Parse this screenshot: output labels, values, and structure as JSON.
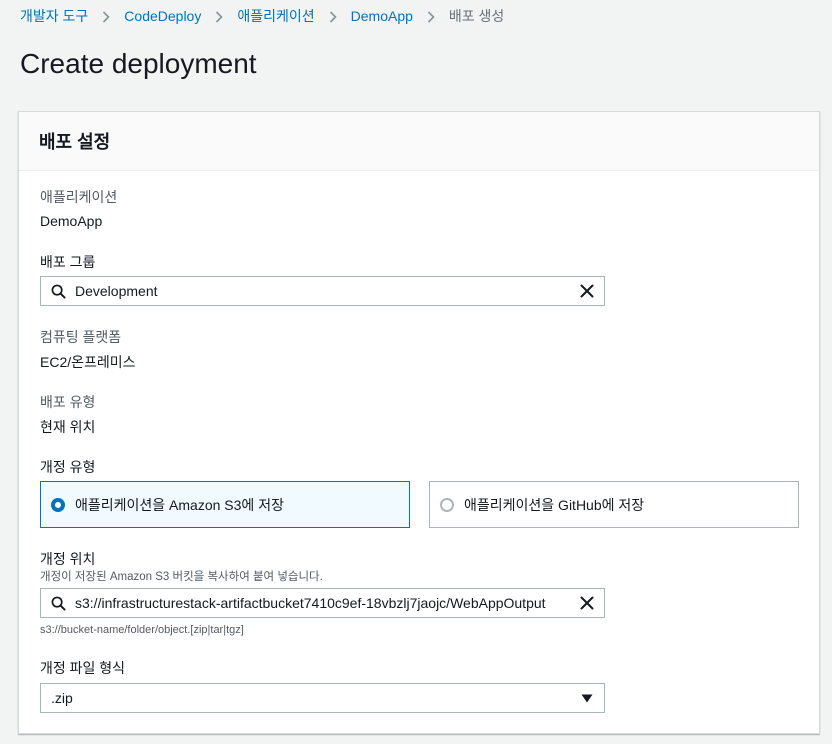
{
  "breadcrumb": [
    {
      "label": "개발자 도구",
      "link": true
    },
    {
      "label": "CodeDeploy",
      "link": true
    },
    {
      "label": "애플리케이션",
      "link": true
    },
    {
      "label": "DemoApp",
      "link": true
    },
    {
      "label": "배포 생성",
      "link": false
    }
  ],
  "page_title": "Create deployment",
  "panel": {
    "title": "배포 설정",
    "application": {
      "label": "애플리케이션",
      "value": "DemoApp"
    },
    "deployment_group": {
      "label": "배포 그룹",
      "value": "Development"
    },
    "compute_platform": {
      "label": "컴퓨팅 플랫폼",
      "value": "EC2/온프레미스"
    },
    "deployment_type": {
      "label": "배포 유형",
      "value": "현재 위치"
    },
    "revision_type": {
      "label": "개정 유형",
      "options": [
        {
          "label": "애플리케이션을 Amazon S3에 저장",
          "selected": true
        },
        {
          "label": "애플리케이션을 GitHub에 저장",
          "selected": false
        }
      ]
    },
    "revision_location": {
      "label": "개정 위치",
      "description": "개정이 저장된 Amazon S3 버킷을 복사하여 붙여 넣습니다.",
      "value": "s3://infrastructurestack-artifactbucket7410c9ef-18vbzlj7jaojc/WebAppOutput",
      "hint": "s3://bucket-name/folder/object.[zip|tar|tgz]"
    },
    "file_type": {
      "label": "개정 파일 형식",
      "value": ".zip"
    }
  },
  "colors": {
    "accent": "#0073bb",
    "text": "#16191f",
    "muted": "#545b64",
    "border": "#aab7b8"
  },
  "icons": {
    "search": "search-icon",
    "clear": "close-icon",
    "caret": "caret-down-icon",
    "separator": "chevron-right-icon"
  }
}
